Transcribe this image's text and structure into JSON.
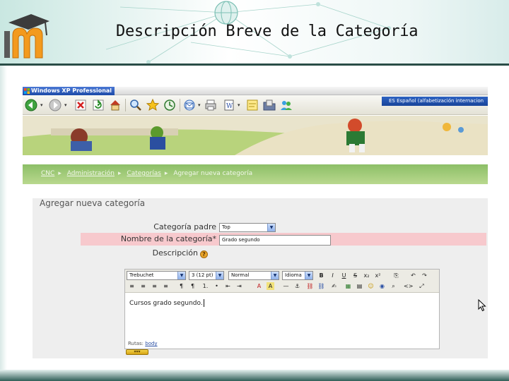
{
  "slide": {
    "title": "Descripción Breve de la Categoría"
  },
  "colors": {
    "header_rule": "#2a4d47",
    "breadcrumb_bar": "#8cbf67",
    "required_highlight": "#f7c9cd",
    "window_tab": "#1c4aa8"
  },
  "window": {
    "tab_label": "Windows XP Professional (2)",
    "language_bar": "ES Español (alfabetización internacion"
  },
  "browser_toolbar": {
    "icons": [
      "back-icon",
      "forward-icon",
      "stop-icon",
      "refresh-icon",
      "home-icon",
      "search-icon",
      "favorites-icon",
      "history-icon",
      "mail-icon",
      "print-icon",
      "edit-icon",
      "discuss-icon",
      "folder-icon",
      "research-icon",
      "messenger-icon"
    ]
  },
  "breadcrumb": {
    "items": [
      "CNC",
      "Administración",
      "Categorías",
      "Agregar nueva categoría"
    ]
  },
  "form": {
    "heading": "Agregar nueva categoría",
    "parent_label": "Categoría padre",
    "parent_value": "Top",
    "name_label": "Nombre de la categoría*",
    "name_value": "Grado segundo",
    "description_label": "Descripción",
    "help_glyph": "?"
  },
  "editor": {
    "font_family": "Trebuchet",
    "font_size": "3 (12 pt)",
    "style": "Normal",
    "language": "Idioma",
    "content": "Cursos grado segundo.",
    "path_label": "Rutas:",
    "path_tag": "body",
    "buttons_row1": [
      "B",
      "I",
      "U",
      "S",
      "x₂",
      "x²",
      "⎘",
      "↶",
      "↷"
    ],
    "buttons_row2": [
      "≡",
      "≡",
      "≡",
      "≡",
      "¶",
      "¶",
      "1.",
      "•",
      "⇤",
      "⇥",
      "A",
      "A",
      "—",
      "⚓",
      "⛓",
      "⛓",
      "✍",
      "▦",
      "▤",
      "☺",
      "◉",
      "⌕",
      "<>",
      "⤢"
    ]
  }
}
